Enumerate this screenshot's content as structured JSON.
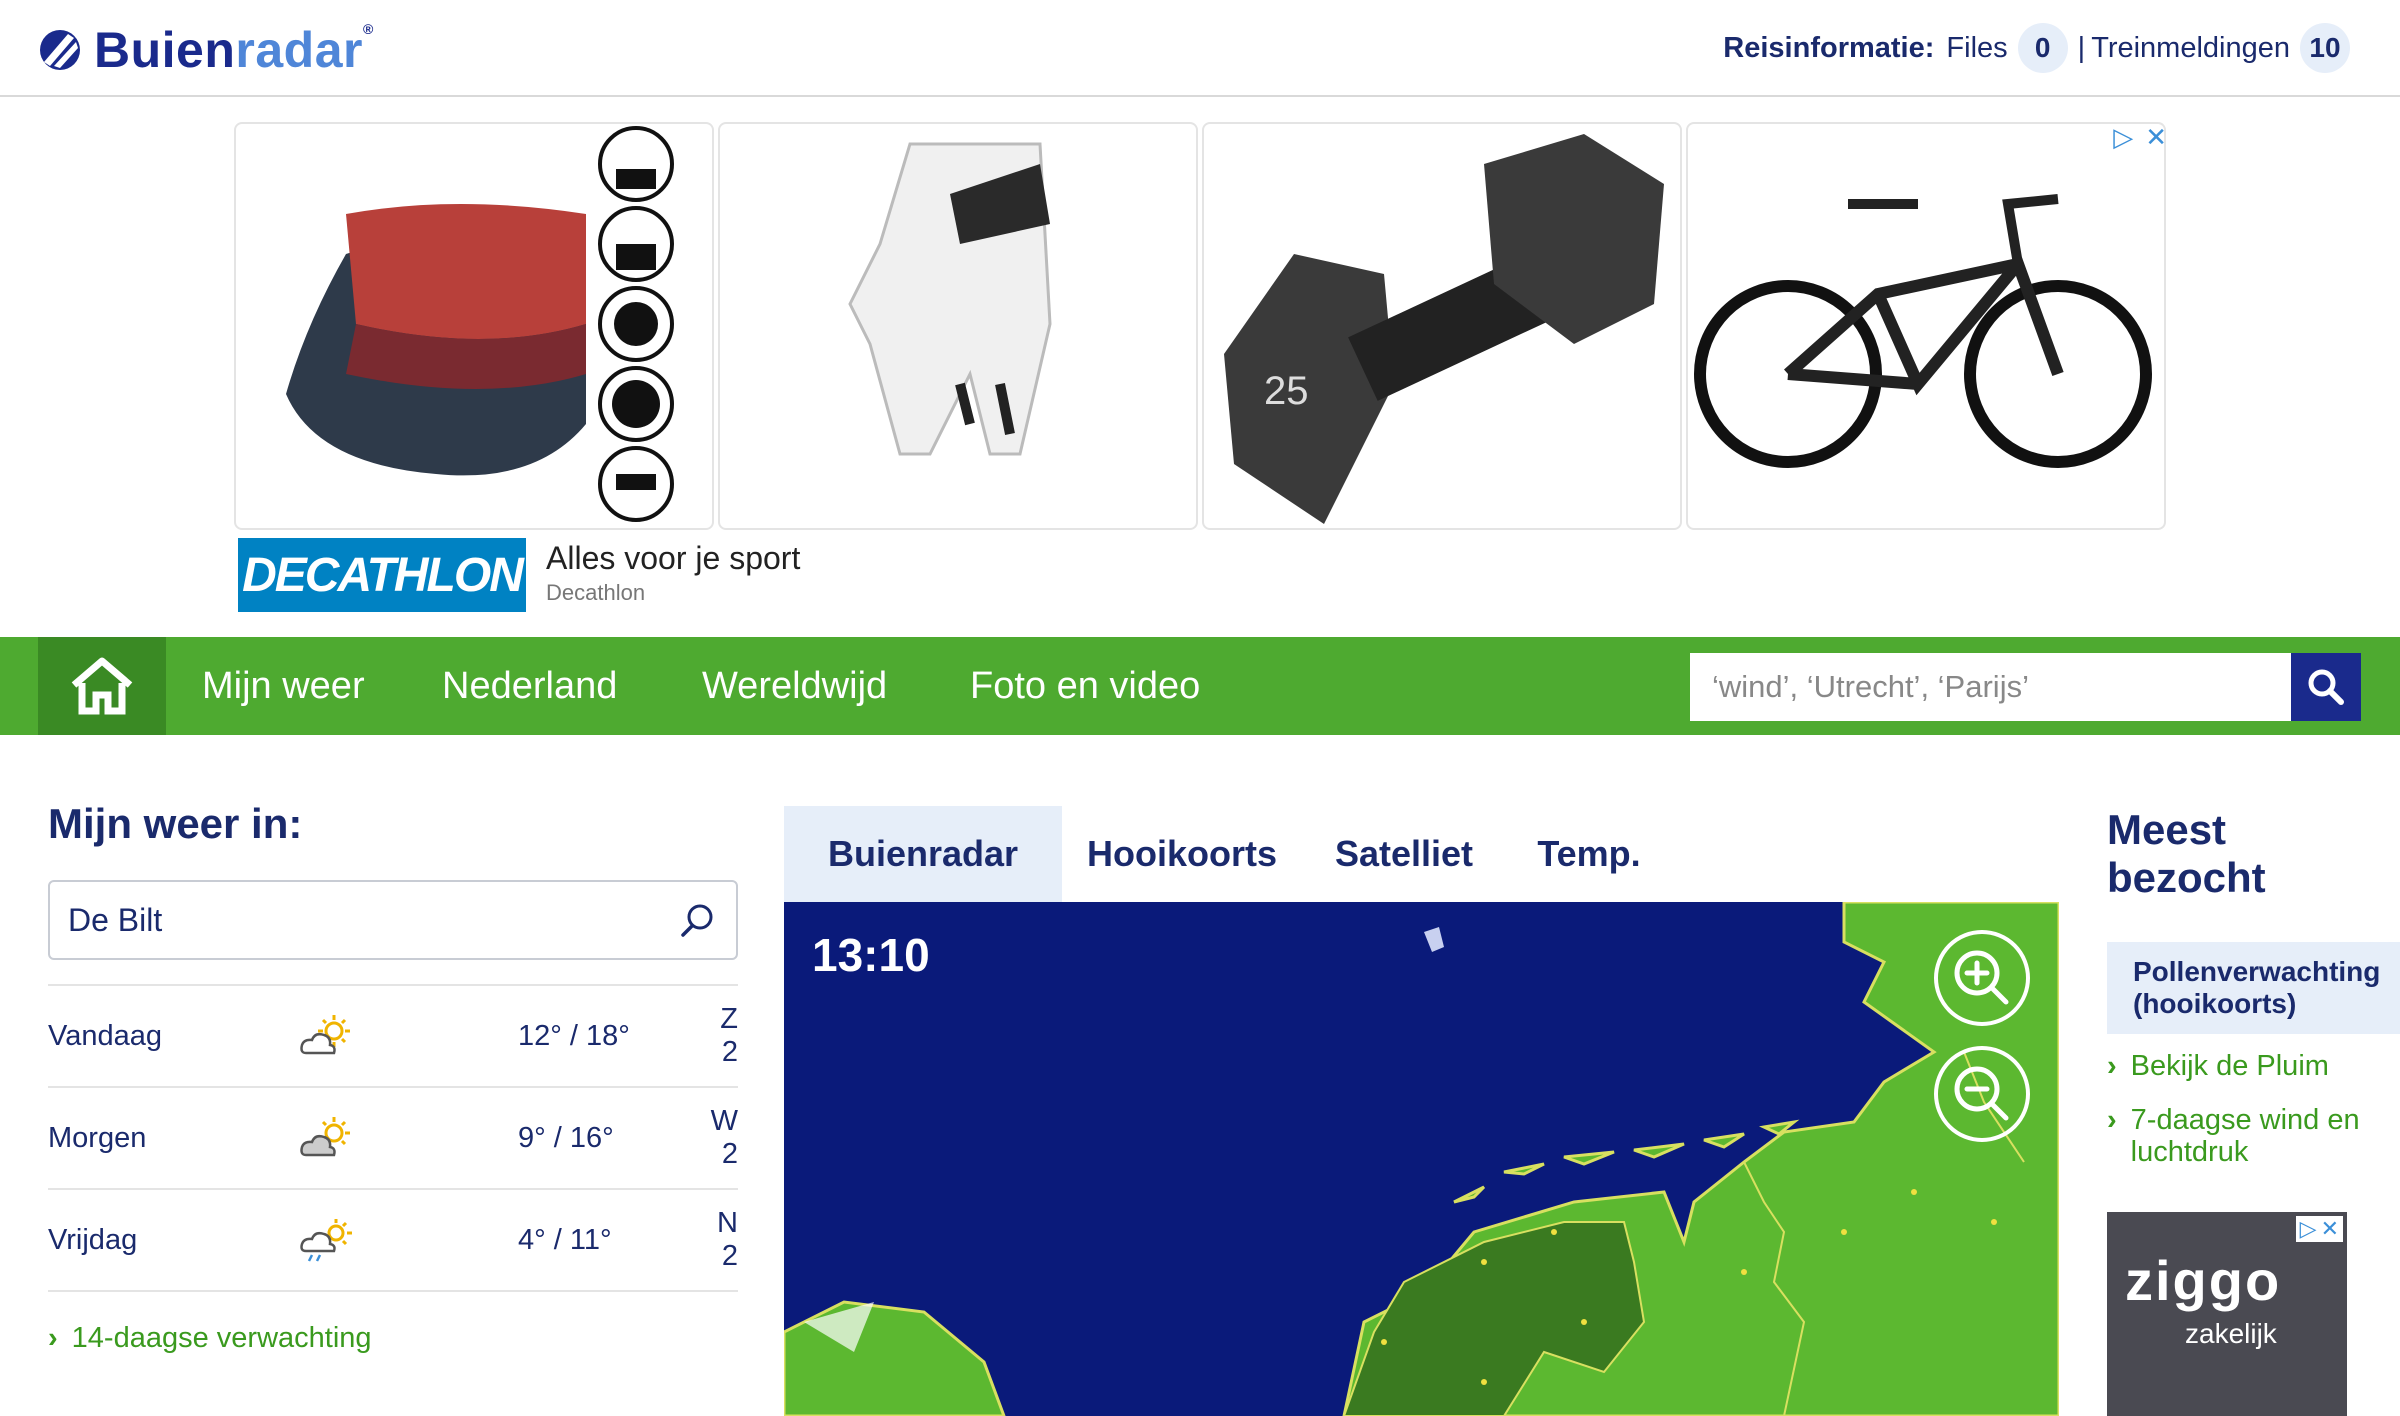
{
  "header": {
    "logo_part1": "Buien",
    "logo_part2": "radar",
    "logo_reg": "®",
    "travel_label": "Reisinformatie:",
    "files_label": "Files",
    "files_count": "0",
    "separator": "|",
    "trains_label": "Treinmeldingen",
    "trains_count": "10"
  },
  "ad": {
    "brand": "DECATHLON",
    "slogan": "Alles voor je sport",
    "advertiser": "Decathlon",
    "adchoices_icon": "▷",
    "close_icon": "✕"
  },
  "nav": {
    "items": [
      "Mijn weer",
      "Nederland",
      "Wereldwijd",
      "Foto en video"
    ],
    "search_placeholder": "‘wind’, ‘Utrecht’, ‘Parijs’"
  },
  "my_weather": {
    "title": "Mijn weer in:",
    "location": "De Bilt",
    "forecast": [
      {
        "day": "Vandaag",
        "temp": "12° / 18°",
        "wind": "Z 2",
        "icon": "sun-cloud-icon"
      },
      {
        "day": "Morgen",
        "temp": "9° / 16°",
        "wind": "W 2",
        "icon": "sun-cloud-icon"
      },
      {
        "day": "Vrijdag",
        "temp": "4° / 11°",
        "wind": "N 2",
        "icon": "sun-cloud-rain-icon"
      }
    ],
    "more_link": "14-daagse verwachting"
  },
  "map": {
    "tabs": [
      "Buienradar",
      "Hooikoorts",
      "Satelliet",
      "Temp."
    ],
    "active_tab": "Buienradar",
    "time": "13:10"
  },
  "most_visited": {
    "title_line1": "Meest",
    "title_line2": "bezocht",
    "highlight": "Pollenverwachting (hooikoorts)",
    "links": [
      "Bekijk de Pluim",
      "7-daagse wind en luchtdruk"
    ]
  },
  "ad2": {
    "brand": "ziggo",
    "sub": "zakelijk"
  },
  "colors": {
    "nav_green": "#4eaa30",
    "nav_home_green": "#3a8a24",
    "navy": "#1a2a6c",
    "link_green": "#3a9a1e",
    "map_sea": "#0a1a7a",
    "map_land": "#5cb830"
  }
}
